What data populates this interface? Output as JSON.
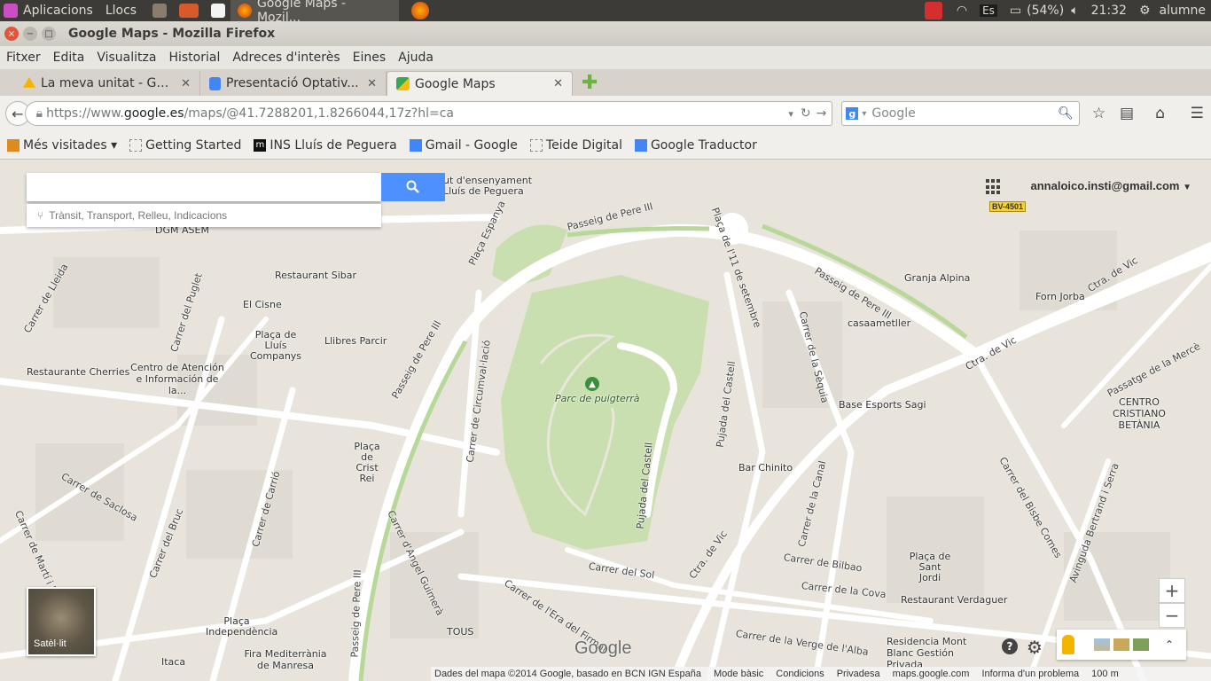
{
  "os_panel": {
    "apps": "Aplicacions",
    "places": "Llocs",
    "task_title": "Google Maps - Mozil...",
    "keyboard": "Es",
    "battery": "(54%)",
    "time": "21:32",
    "user": "alumne"
  },
  "window": {
    "title": "Google Maps - Mozilla Firefox"
  },
  "menu": [
    "Fitxer",
    "Edita",
    "Visualitza",
    "Historial",
    "Adreces d'interès",
    "Eines",
    "Ajuda"
  ],
  "tabs": [
    {
      "label": "La meva unitat - Goo...",
      "icon_color": "#f4b400"
    },
    {
      "label": "Presentació Optativ...",
      "icon_color": "#4285f4"
    },
    {
      "label": "Google Maps",
      "icon_color": "#34a853"
    }
  ],
  "navbar": {
    "url_prefix": "https://www.",
    "url_domain": "google.es",
    "url_path": "/maps/@41.7288201,1.8266044,17z?hl=ca",
    "search_placeholder": "Google"
  },
  "bookmarks": [
    {
      "label": "Més visitades ▾",
      "icon": "most-visited-icon"
    },
    {
      "label": "Getting Started",
      "icon": "page-icon"
    },
    {
      "label": "INS Lluís de Peguera",
      "icon": "moodle-icon"
    },
    {
      "label": "Gmail - Google",
      "icon": "google-icon"
    },
    {
      "label": "Teide Digital",
      "icon": "page-icon"
    },
    {
      "label": "Google Traductor",
      "icon": "google-icon"
    }
  ],
  "maps": {
    "search_value": "",
    "hint": "Trànsit, Transport, Relleu, Indicacions",
    "account": "annaloico.insti@gmail.com",
    "satellite_label": "Satèl·lit",
    "zoom_in": "+",
    "zoom_out": "−",
    "logo": "Google",
    "road_badge": "BV-4501",
    "footer": [
      "Dades del mapa ©2014 Google, basado en BCN IGN España",
      "Mode bàsic",
      "Condicions",
      "Privadesa",
      "maps.google.com",
      "Informa d'un problema",
      "100 m"
    ],
    "places": [
      "DGM ASEM",
      "Restaurant Sibar",
      "El Cisne",
      "Plaça de Lluís Companys",
      "Llibres Parcir",
      "Restaurante Cherries",
      "Centro de Atención e Información de la...",
      "Plaça de Crist Rei",
      "Parc de puigterrà",
      "Granja Alpina",
      "Forn Jorba",
      "casaametller",
      "Base Esports Sagi",
      "CENTRO CRISTIANO BETÀNIA",
      "Bar Chinito",
      "Plaça de Sant Jordi",
      "Restaurant Verdaguer",
      "Residencia Mont Blanc Gestión Privada",
      "Fira Mediterrània de Manresa",
      "Plaça Independència",
      "TOUS",
      "Itaca",
      "ut d'ensenyament Lluís de Peguera"
    ],
    "streets": [
      "Passeig de Pere III",
      "Plaça Espanya",
      "Plaça de l'11 de setembre",
      "Carrer de Lleida",
      "Carrer del Puglet",
      "Carrer de Circumval·lació",
      "Carrer de Saclosa",
      "Carrer del Bruc",
      "Carrer de Carrió",
      "Carrer d'Angel Guimerà",
      "Pujada del Castell",
      "Carrer del Sol",
      "Ctra. de Vic",
      "Carrer de la Sèquia",
      "Carrer de la Canal",
      "Carrer de Bilbao",
      "Carrer de la Cova",
      "Carrer del Bisbe Comes",
      "Avinguda Bertrand i Serra",
      "Passatge de la Mercè",
      "Carrer de Martí i Julià",
      "Carrer de l'Era del Firmat",
      "Carrer de la Verge de l'Alba"
    ]
  }
}
